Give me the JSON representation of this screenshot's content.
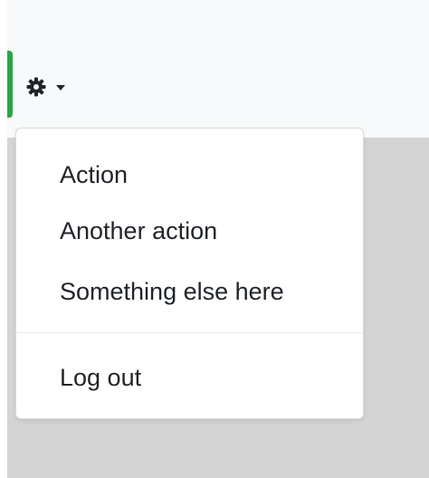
{
  "navbar": {
    "settings_icon": "gear-icon",
    "caret_icon": "caret-down-icon"
  },
  "dropdown": {
    "items": [
      {
        "label": "Action"
      },
      {
        "label": "Another action"
      },
      {
        "label": "Something else here"
      },
      {
        "label": "Log out"
      }
    ]
  },
  "colors": {
    "accent": "#28a745",
    "navbar_bg": "#f8f9fa",
    "content_bg": "#d4d4d4",
    "text": "#212529"
  }
}
